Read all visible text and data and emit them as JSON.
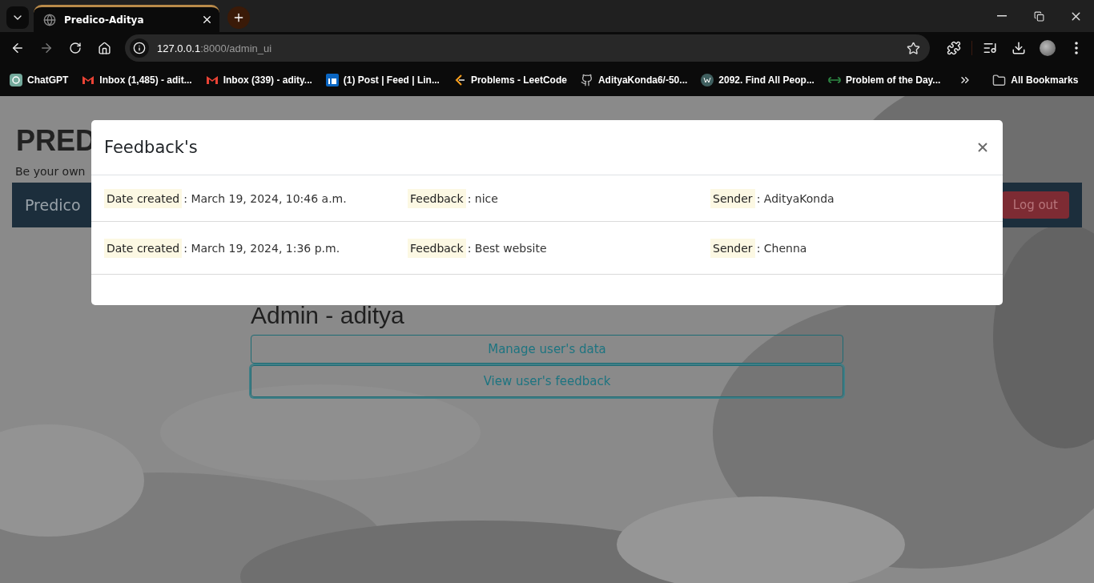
{
  "browser": {
    "tab": {
      "title": "Predico-Aditya",
      "selected": true
    },
    "url": {
      "host": "127.0.0.1",
      "path": ":8000/admin_ui"
    },
    "bookmarks": [
      {
        "label": "ChatGPT"
      },
      {
        "label": "Inbox (1,485) - adit..."
      },
      {
        "label": "Inbox (339) - adity..."
      },
      {
        "label": "(1) Post | Feed | Lin..."
      },
      {
        "label": "Problems - LeetCode"
      },
      {
        "label": "AdityaKonda6/-50..."
      },
      {
        "label": "2092. Find All Peop..."
      },
      {
        "label": "Problem of the Day..."
      }
    ],
    "all_bookmarks": "All Bookmarks"
  },
  "page": {
    "brand": "PRED",
    "tagline": "Be your own",
    "navbar": {
      "brand": "Predico",
      "logout": "Log out"
    },
    "heading": "Admin - aditya",
    "actions": [
      {
        "label": "Manage user's data",
        "focused": false
      },
      {
        "label": "View user's feedback",
        "focused": true
      }
    ]
  },
  "modal": {
    "title": "Feedback's",
    "rows": [
      {
        "fields": [
          {
            "label": "Date created",
            "separator": ":",
            "value": "March 19, 2024, 10:46 a.m."
          },
          {
            "label": "Feedback",
            "separator": ":",
            "value": "nice"
          },
          {
            "label": "Sender",
            "separator": ":",
            "value": "AdityaKonda"
          }
        ]
      },
      {
        "fields": [
          {
            "label": "Date created",
            "separator": ":",
            "value": "March 19, 2024, 1:36 p.m."
          },
          {
            "label": "Feedback",
            "separator": ":",
            "value": "Best website"
          },
          {
            "label": "Sender",
            "separator": ":",
            "value": "Chenna"
          }
        ]
      }
    ]
  }
}
